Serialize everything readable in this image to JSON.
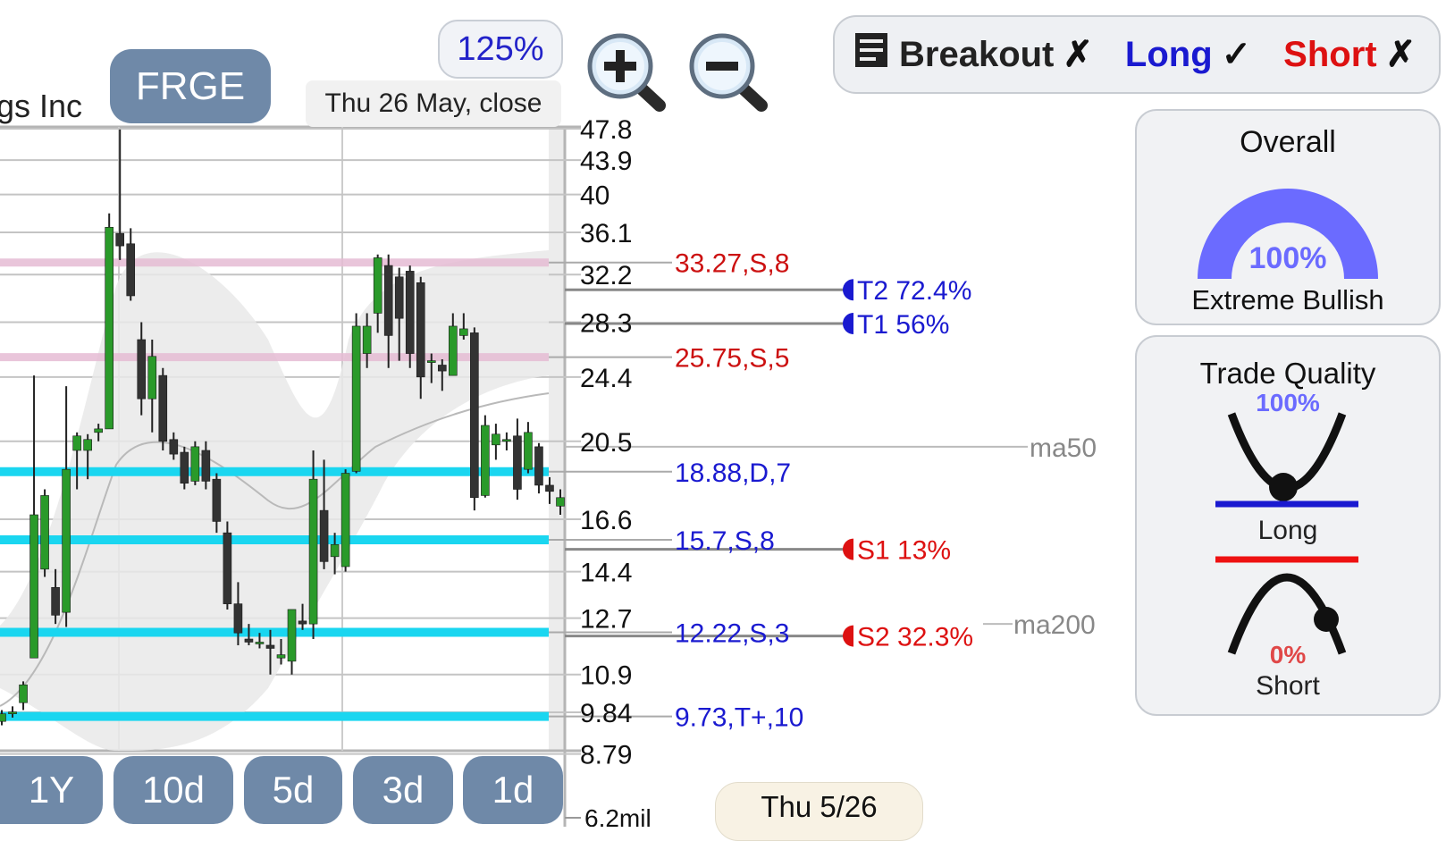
{
  "company_name_partial": "gs Inc",
  "ticker": "FRGE",
  "zoom_level": "125%",
  "date_label": "Thu 26 May, close",
  "toolbar": {
    "breakout_label": "Breakout",
    "breakout_mark": "✗",
    "long_label": "Long",
    "long_mark": "✓",
    "short_label": "Short",
    "short_mark": "✗"
  },
  "overall": {
    "title": "Overall",
    "percent": "100%",
    "percent_value": 1.0,
    "label": "Extreme Bullish"
  },
  "trade_quality": {
    "title": "Trade Quality",
    "long_percent": "100%",
    "long_label": "Long",
    "short_percent": "0%",
    "short_label": "Short"
  },
  "price_axis_ticks": [
    "47.8",
    "43.9",
    "40",
    "36.1",
    "32.2",
    "28.3",
    "24.4",
    "20.5",
    "16.6",
    "14.4",
    "12.7",
    "10.9",
    "9.84",
    "8.79"
  ],
  "volume_tick": "6.2mil",
  "level_labels": [
    {
      "text": "33.27,S,8",
      "color": "#cc1111"
    },
    {
      "text": "25.75,S,5",
      "color": "#cc1111"
    },
    {
      "text": "18.88,D,7",
      "color": "#1a1ad0"
    },
    {
      "text": "15.7,S,8",
      "color": "#1a1ad0"
    },
    {
      "text": "12.22,S,3",
      "color": "#1a1ad0"
    },
    {
      "text": "9.73,T+,10",
      "color": "#1a1ad0"
    }
  ],
  "targets": {
    "t2": "T2 72.4%",
    "t1": "T1 56%",
    "s1": "S1 13%",
    "s2": "S2 32.3%"
  },
  "ma_labels": {
    "ma50": "ma50",
    "ma200": "ma200"
  },
  "periods": [
    "1Y",
    "10d",
    "5d",
    "3d",
    "1d"
  ],
  "footer_date": "Thu 5/26",
  "colors": {
    "accent_blue": "#1a1ad0",
    "bearish_red": "#dd1111",
    "support_cyan": "#1ad6f0",
    "resistance_pink": "#e6bcd4",
    "candle_up": "#2a9a2a",
    "candle_down": "#333333",
    "gauge": "#6b6bff",
    "pill_bg": "#6f89a8"
  },
  "chart_data": {
    "type": "candlestick",
    "candles": [
      {
        "o": 9.6,
        "h": 9.9,
        "l": 9.5,
        "c": 9.8
      },
      {
        "o": 9.8,
        "h": 10.0,
        "l": 9.7,
        "c": 9.85
      },
      {
        "o": 10.1,
        "h": 10.7,
        "l": 9.9,
        "c": 10.6
      },
      {
        "o": 11.4,
        "h": 24.5,
        "l": 11.4,
        "c": 16.8
      },
      {
        "o": 14.5,
        "h": 18.0,
        "l": 14.2,
        "c": 17.7
      },
      {
        "o": 13.8,
        "h": 14.5,
        "l": 12.5,
        "c": 12.8
      },
      {
        "o": 12.9,
        "h": 23.8,
        "l": 12.4,
        "c": 19.0
      },
      {
        "o": 20.0,
        "h": 21.0,
        "l": 18.0,
        "c": 20.8
      },
      {
        "o": 20.0,
        "h": 20.9,
        "l": 18.5,
        "c": 20.6
      },
      {
        "o": 21.0,
        "h": 21.5,
        "l": 20.5,
        "c": 21.2
      },
      {
        "o": 21.2,
        "h": 38.0,
        "l": 21.2,
        "c": 36.6
      },
      {
        "o": 36.0,
        "h": 47.7,
        "l": 33.5,
        "c": 34.8
      },
      {
        "o": 35.0,
        "h": 36.5,
        "l": 30.0,
        "c": 30.4
      },
      {
        "o": 27.0,
        "h": 28.3,
        "l": 22.0,
        "c": 23.0
      },
      {
        "o": 23.0,
        "h": 27.0,
        "l": 21.0,
        "c": 25.8
      },
      {
        "o": 24.5,
        "h": 25.0,
        "l": 20.0,
        "c": 20.5
      },
      {
        "o": 20.6,
        "h": 21.0,
        "l": 19.5,
        "c": 19.8
      },
      {
        "o": 19.9,
        "h": 20.2,
        "l": 18.0,
        "c": 18.3
      },
      {
        "o": 18.4,
        "h": 20.5,
        "l": 18.2,
        "c": 20.2
      },
      {
        "o": 20.0,
        "h": 20.5,
        "l": 18.0,
        "c": 18.4
      },
      {
        "o": 18.5,
        "h": 18.8,
        "l": 16.0,
        "c": 16.5
      },
      {
        "o": 16.0,
        "h": 16.5,
        "l": 13.0,
        "c": 13.2
      },
      {
        "o": 13.2,
        "h": 14.0,
        "l": 11.8,
        "c": 12.2
      },
      {
        "o": 12.0,
        "h": 12.5,
        "l": 11.8,
        "c": 11.9
      },
      {
        "o": 11.9,
        "h": 12.2,
        "l": 11.7,
        "c": 11.9
      },
      {
        "o": 11.8,
        "h": 12.3,
        "l": 10.9,
        "c": 11.7
      },
      {
        "o": 11.4,
        "h": 12.0,
        "l": 11.2,
        "c": 11.5
      },
      {
        "o": 11.3,
        "h": 13.0,
        "l": 10.9,
        "c": 13.0
      },
      {
        "o": 12.6,
        "h": 13.2,
        "l": 12.3,
        "c": 12.5
      },
      {
        "o": 12.5,
        "h": 20.0,
        "l": 12.0,
        "c": 18.5
      },
      {
        "o": 17.0,
        "h": 19.5,
        "l": 14.5,
        "c": 14.8
      },
      {
        "o": 15.0,
        "h": 16.0,
        "l": 14.3,
        "c": 15.5
      },
      {
        "o": 14.6,
        "h": 19.0,
        "l": 14.4,
        "c": 18.8
      },
      {
        "o": 18.9,
        "h": 29.0,
        "l": 18.8,
        "c": 28.0
      },
      {
        "o": 26.0,
        "h": 29.0,
        "l": 25.0,
        "c": 28.0
      },
      {
        "o": 29.0,
        "h": 34.0,
        "l": 27.5,
        "c": 33.7
      },
      {
        "o": 33.0,
        "h": 34.0,
        "l": 25.0,
        "c": 27.3
      },
      {
        "o": 32.0,
        "h": 32.8,
        "l": 25.5,
        "c": 28.6
      },
      {
        "o": 32.5,
        "h": 33.0,
        "l": 25.0,
        "c": 26.0
      },
      {
        "o": 31.5,
        "h": 32.0,
        "l": 23.0,
        "c": 24.4
      },
      {
        "o": 25.5,
        "h": 26.0,
        "l": 24.0,
        "c": 25.5
      },
      {
        "o": 25.2,
        "h": 25.6,
        "l": 23.5,
        "c": 24.8
      },
      {
        "o": 24.5,
        "h": 29.0,
        "l": 24.5,
        "c": 28.0
      },
      {
        "o": 27.3,
        "h": 29.0,
        "l": 27.0,
        "c": 27.8
      },
      {
        "o": 27.5,
        "h": 27.9,
        "l": 17.0,
        "c": 17.6
      },
      {
        "o": 17.7,
        "h": 22.0,
        "l": 17.6,
        "c": 21.4
      },
      {
        "o": 20.3,
        "h": 21.5,
        "l": 19.5,
        "c": 20.9
      },
      {
        "o": 20.5,
        "h": 21.0,
        "l": 20.0,
        "c": 20.6
      },
      {
        "o": 20.8,
        "h": 21.8,
        "l": 17.5,
        "c": 18.0
      },
      {
        "o": 19.0,
        "h": 21.6,
        "l": 18.8,
        "c": 21.0
      },
      {
        "o": 20.2,
        "h": 20.4,
        "l": 17.8,
        "c": 18.2
      },
      {
        "o": 18.2,
        "h": 18.6,
        "l": 17.3,
        "c": 17.9
      },
      {
        "o": 17.2,
        "h": 18.0,
        "l": 16.8,
        "c": 17.6
      }
    ],
    "support_levels": [
      18.88,
      15.7,
      12.22,
      9.73
    ],
    "resistance_levels": [
      33.27,
      25.75
    ],
    "targets": [
      {
        "name": "T2",
        "price": 30.9
      },
      {
        "name": "T1",
        "price": 28.2
      }
    ],
    "stops": [
      {
        "name": "S1",
        "price": 15.3
      },
      {
        "name": "S2",
        "price": 12.1
      }
    ],
    "ma50_end": 20.2,
    "ma200_end": 12.5,
    "ylim": [
      8.5,
      48.5
    ],
    "log_scale": true,
    "grid": true
  }
}
